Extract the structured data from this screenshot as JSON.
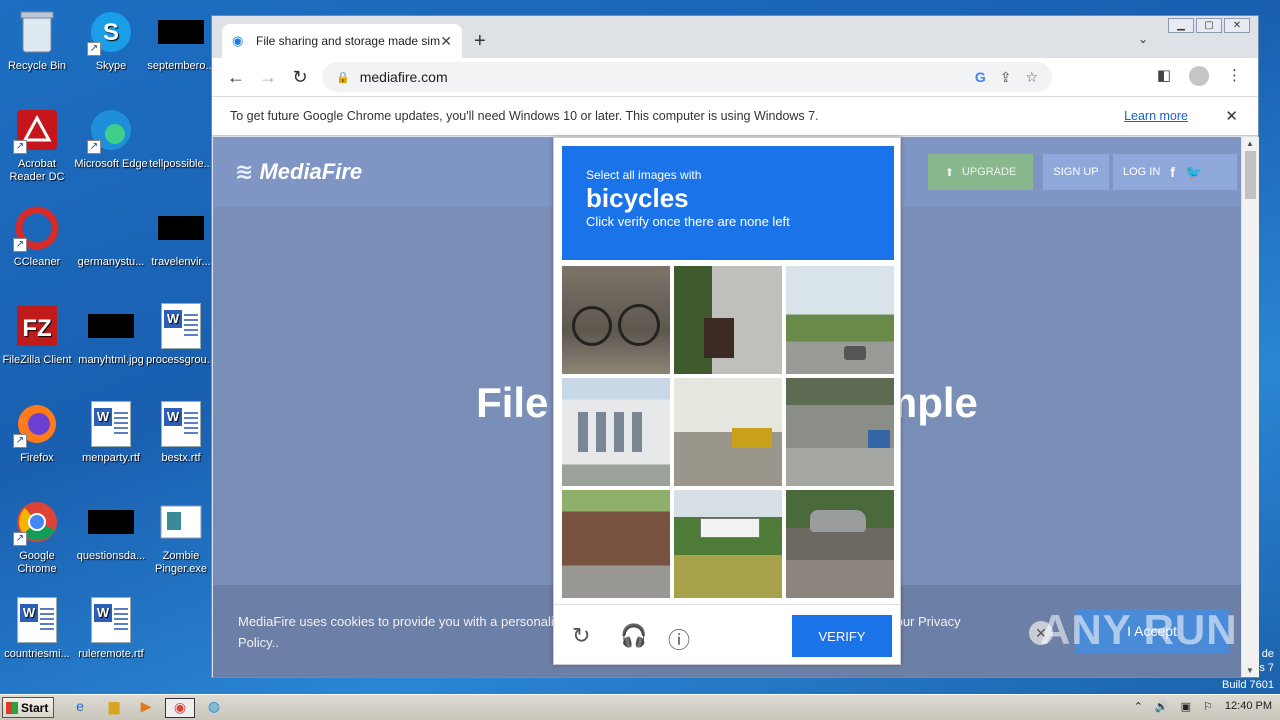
{
  "desktop": {
    "icons": [
      {
        "label": "Recycle Bin"
      },
      {
        "label": "Skype"
      },
      {
        "label": "septembero..."
      },
      {
        "label": "Acrobat Reader DC"
      },
      {
        "label": "Microsoft Edge"
      },
      {
        "label": "tellpossible..."
      },
      {
        "label": "CCleaner"
      },
      {
        "label": "germanystu..."
      },
      {
        "label": "travelenvir..."
      },
      {
        "label": "FileZilla Client"
      },
      {
        "label": "manyhtml.jpg"
      },
      {
        "label": "processgrou..."
      },
      {
        "label": "Firefox"
      },
      {
        "label": "menparty.rtf"
      },
      {
        "label": "bestx.rtf"
      },
      {
        "label": "Google Chrome"
      },
      {
        "label": "questionsda..."
      },
      {
        "label": "Zombie Pinger.exe"
      },
      {
        "label": "countriesmi..."
      },
      {
        "label": "ruleremote.rtf"
      }
    ],
    "watermark": "ANY RUN",
    "winver_line1": "de",
    "winver_line2": "s 7",
    "winver_line3": "Build 7601"
  },
  "browser": {
    "tab_title": "File sharing and storage made simple",
    "tab_close": "✕",
    "new_tab": "+",
    "url": "mediafire.com",
    "infobar_text": "To get future Google Chrome updates, you'll need Windows 10 or later. This computer is using Windows 7.",
    "infobar_link": "Learn more"
  },
  "mediafire": {
    "logo": "MediaFire",
    "upgrade": "UPGRADE",
    "signup": "SIGN UP",
    "login": "LOG IN",
    "hero": "File storage made simple",
    "cookie_text": "MediaFire uses cookies to provide you with a personalized experience. By continuing to use our site, you agree to our Privacy Policy..",
    "accept": "I Accept"
  },
  "captcha": {
    "instruction_small": "Select all images with",
    "target": "bicycles",
    "instruction_sub": "Click verify once there are none left",
    "verify": "VERIFY"
  },
  "taskbar": {
    "start": "Start",
    "clock": "12:40 PM"
  }
}
